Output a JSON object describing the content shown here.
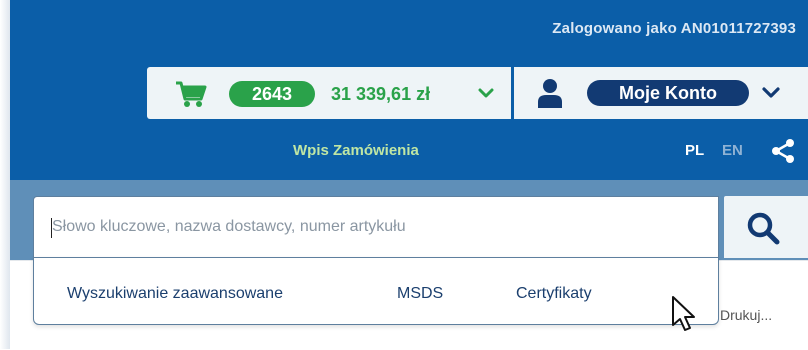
{
  "header": {
    "logged_in_as": "Zalogowano jako AN01011727393",
    "order_entry": "Wpis Zamówienia",
    "languages": [
      {
        "code": "PL",
        "active": true
      },
      {
        "code": "EN",
        "active": false
      }
    ]
  },
  "cart": {
    "count": "2643",
    "total": "31 339,61 zł",
    "icon": "cart-icon",
    "color": "#2aa24a"
  },
  "account": {
    "label": "Moje Konto",
    "icon": "user-icon",
    "color": "#123a73"
  },
  "search": {
    "placeholder": "Słowo kluczowe, nazwa dostawcy, numer artykułu",
    "value": "",
    "icon": "search-icon",
    "options": [
      {
        "label": "Wyszukiwanie zaawansowane"
      },
      {
        "label": "MSDS"
      },
      {
        "label": "Certyfikaty"
      }
    ]
  },
  "page": {
    "print_label": "Drukuj..."
  },
  "colors": {
    "header_bg": "#0b5ea8",
    "search_band_bg": "#5f8fb8",
    "link": "#1b3f6e"
  }
}
